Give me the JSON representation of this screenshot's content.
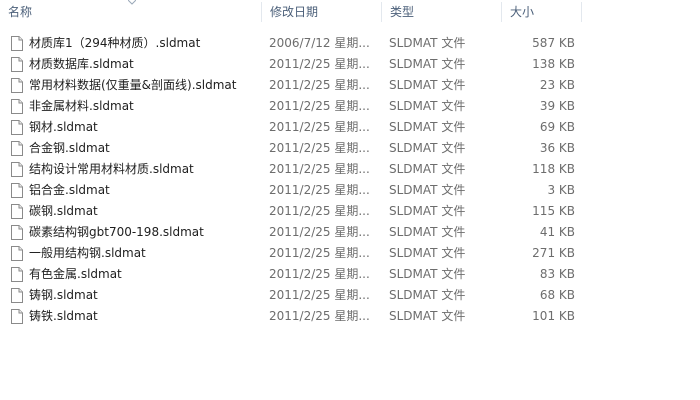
{
  "columns": {
    "name": "名称",
    "date": "修改日期",
    "type": "类型",
    "size": "大小"
  },
  "icon": "document-file-icon",
  "files": [
    {
      "name": "材质库1（294种材质）.sldmat",
      "date": "2006/7/12 星期...",
      "type": "SLDMAT 文件",
      "size": "587 KB"
    },
    {
      "name": "材质数据库.sldmat",
      "date": "2011/2/25 星期...",
      "type": "SLDMAT 文件",
      "size": "138 KB"
    },
    {
      "name": "常用材料数据(仅重量&剖面线).sldmat",
      "date": "2011/2/25 星期...",
      "type": "SLDMAT 文件",
      "size": "23 KB"
    },
    {
      "name": "非金属材料.sldmat",
      "date": "2011/2/25 星期...",
      "type": "SLDMAT 文件",
      "size": "39 KB"
    },
    {
      "name": "钢材.sldmat",
      "date": "2011/2/25 星期...",
      "type": "SLDMAT 文件",
      "size": "69 KB"
    },
    {
      "name": "合金钢.sldmat",
      "date": "2011/2/25 星期...",
      "type": "SLDMAT 文件",
      "size": "36 KB"
    },
    {
      "name": "结构设计常用材料材质.sldmat",
      "date": "2011/2/25 星期...",
      "type": "SLDMAT 文件",
      "size": "118 KB"
    },
    {
      "name": "铝合金.sldmat",
      "date": "2011/2/25 星期...",
      "type": "SLDMAT 文件",
      "size": "3 KB"
    },
    {
      "name": "碳钢.sldmat",
      "date": "2011/2/25 星期...",
      "type": "SLDMAT 文件",
      "size": "115 KB"
    },
    {
      "name": "碳素结构钢gbt700-198.sldmat",
      "date": "2011/2/25 星期...",
      "type": "SLDMAT 文件",
      "size": "41 KB"
    },
    {
      "name": "一般用结构钢.sldmat",
      "date": "2011/2/25 星期...",
      "type": "SLDMAT 文件",
      "size": "271 KB"
    },
    {
      "name": "有色金属.sldmat",
      "date": "2011/2/25 星期...",
      "type": "SLDMAT 文件",
      "size": "83 KB"
    },
    {
      "name": "铸钢.sldmat",
      "date": "2011/2/25 星期...",
      "type": "SLDMAT 文件",
      "size": "68 KB"
    },
    {
      "name": "铸铁.sldmat",
      "date": "2011/2/25 星期...",
      "type": "SLDMAT 文件",
      "size": "101 KB"
    }
  ]
}
